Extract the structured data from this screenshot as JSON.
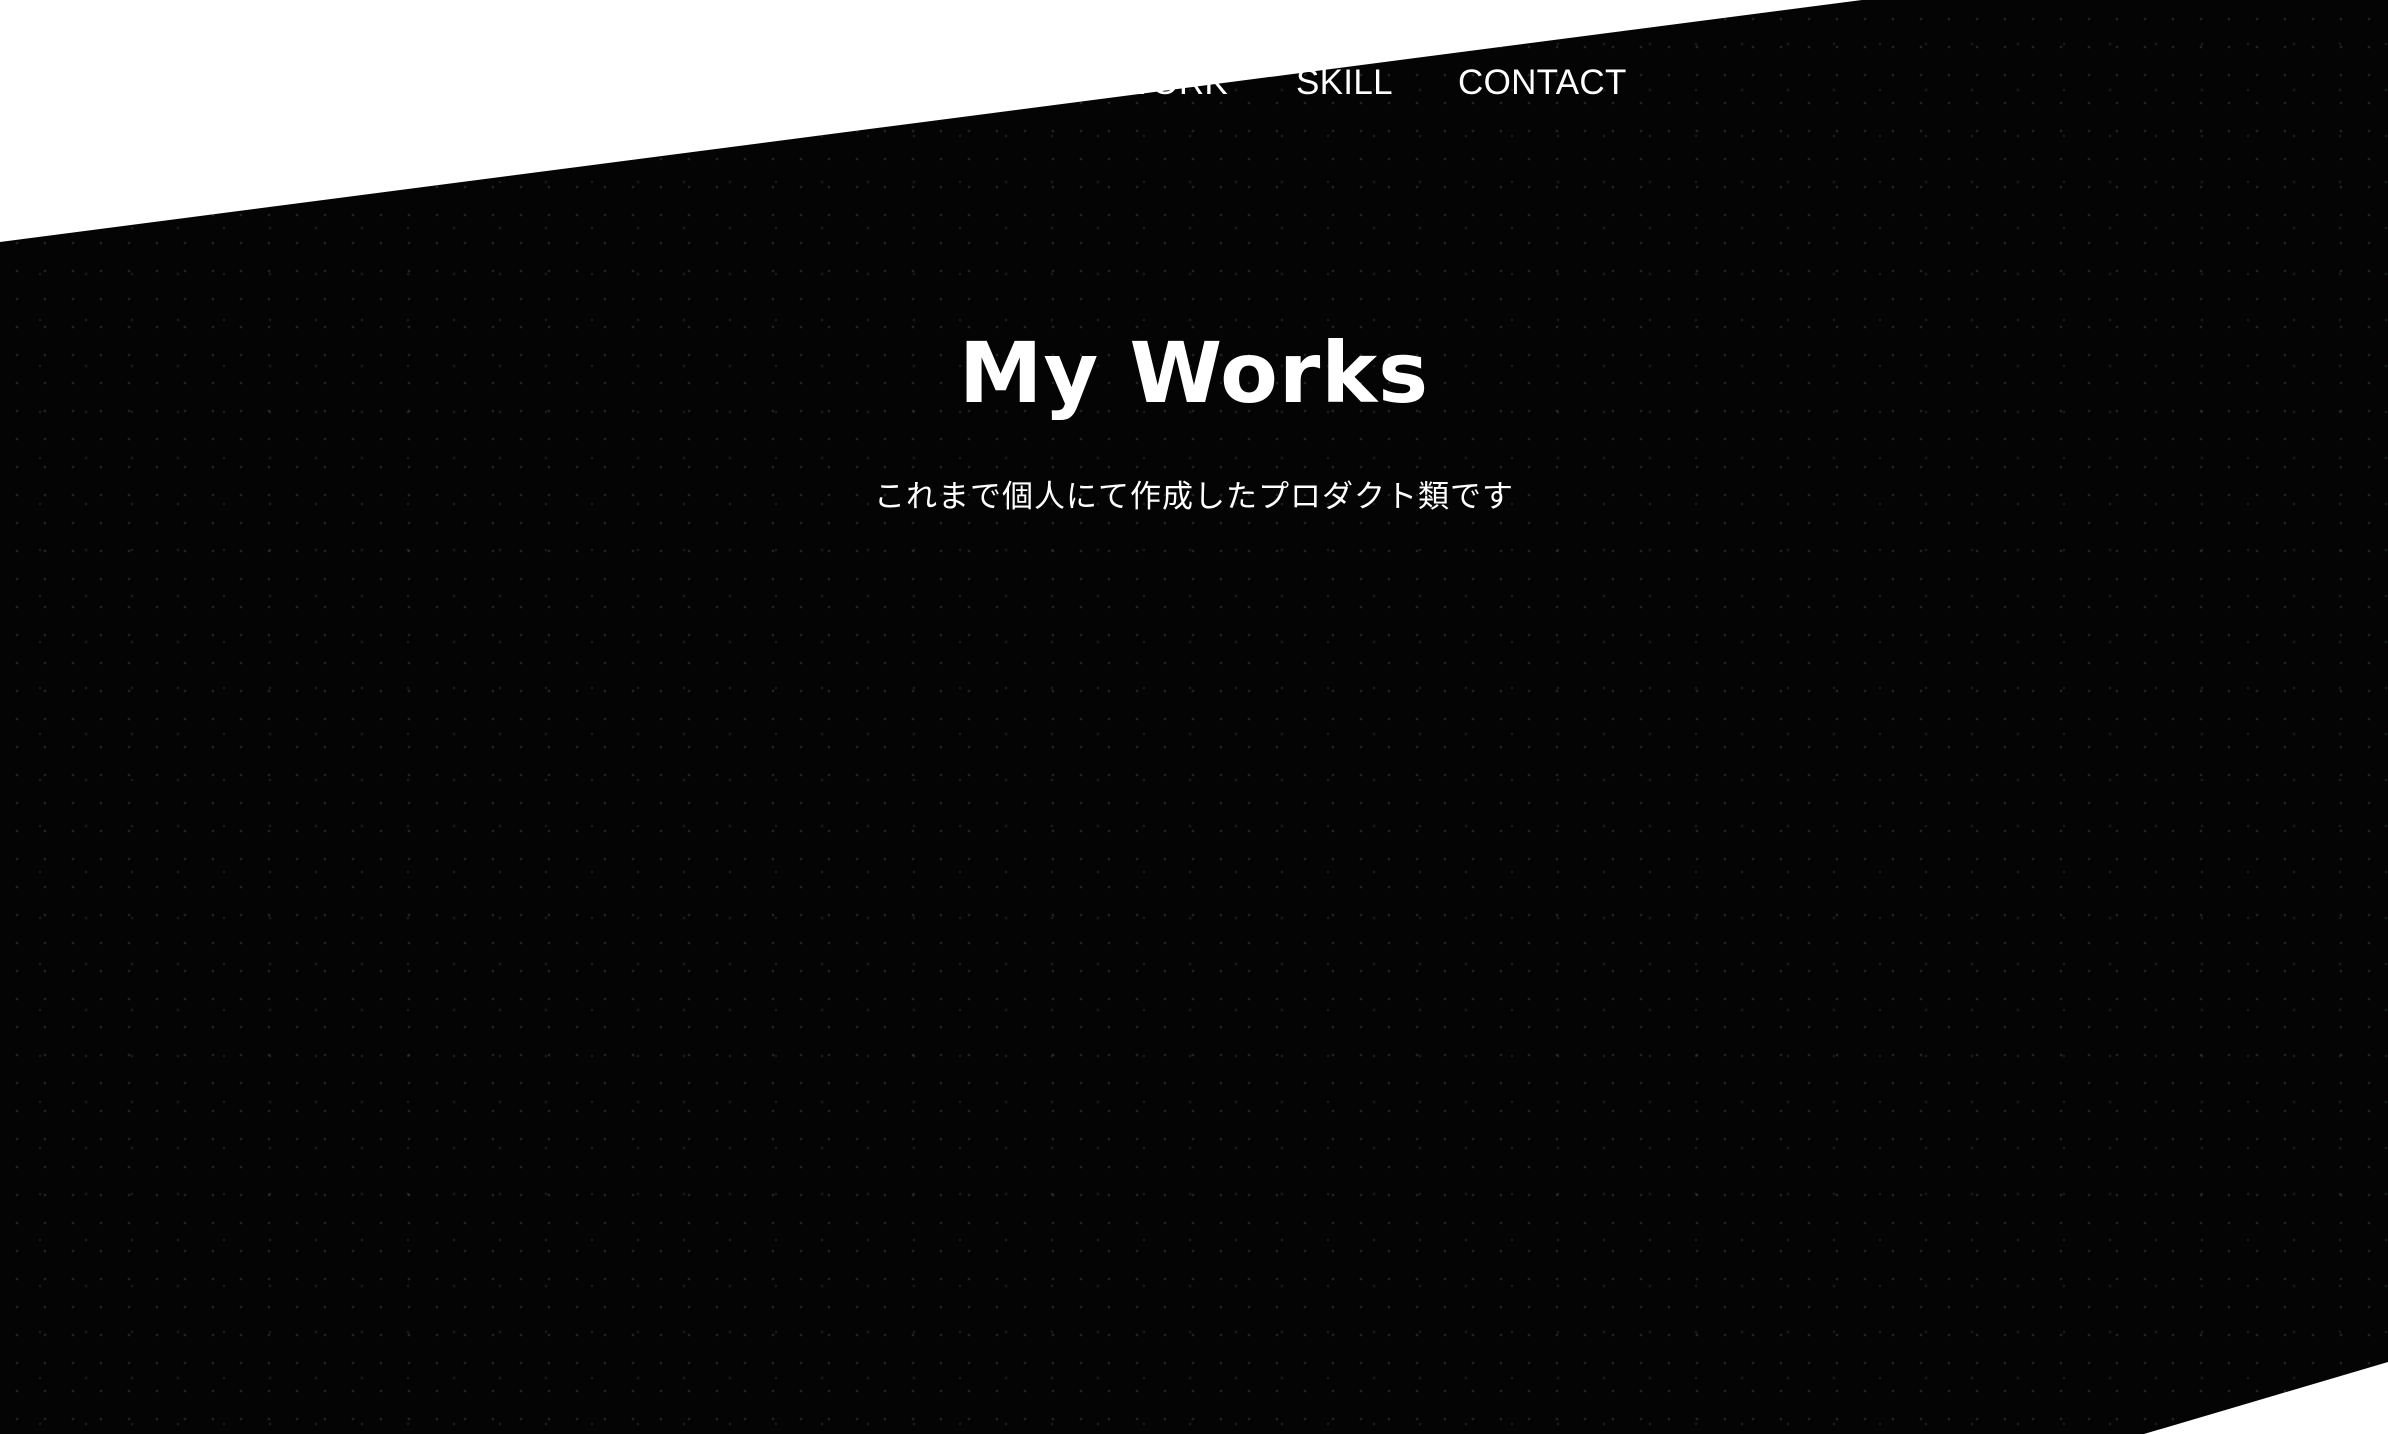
{
  "nav": {
    "items": [
      {
        "label": "WORK"
      },
      {
        "label": "SKILL"
      },
      {
        "label": "CONTACT"
      }
    ]
  },
  "hero": {
    "title": "My Works",
    "subtitle": "これまで個人にて作成したプロダクト類です"
  },
  "colors": {
    "background_dark": "#040404",
    "background_light": "#ffffff",
    "text": "#ffffff",
    "dot_accent": "#5aaa64"
  }
}
